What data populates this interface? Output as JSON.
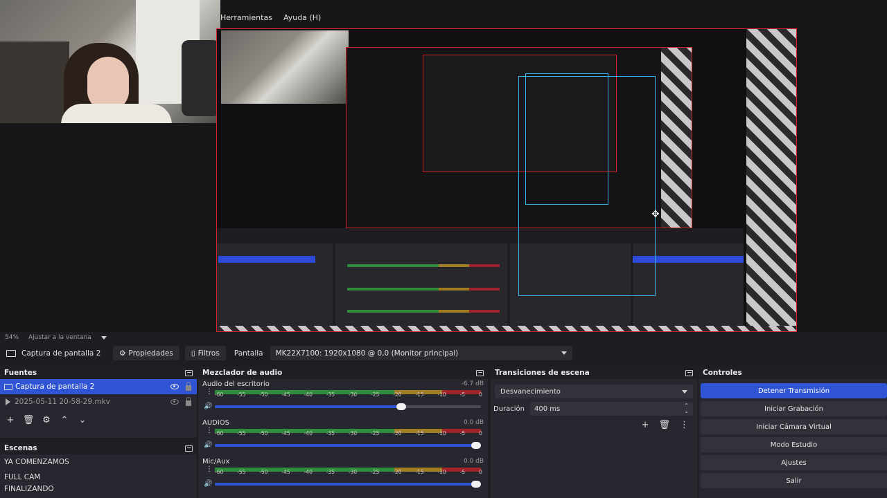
{
  "menu": {
    "tools": "Herramientas",
    "help": "Ayuda (H)"
  },
  "zoom": {
    "percent": "54%",
    "fit_label": "Ajustar a la ventana"
  },
  "source_toolbar": {
    "source_name": "Captura de pantalla 2",
    "properties_label": "Propiedades",
    "filters_label": "Filtros",
    "display_label": "Pantalla",
    "display_value": "MK22X7100: 1920x1080 @ 0,0 (Monitor principal)"
  },
  "sources": {
    "title": "Fuentes",
    "items": [
      {
        "label": "Captura de pantalla 2",
        "selected": true,
        "visible": true
      },
      {
        "label": "2025-05-11 20-58-29.mkv",
        "selected": false,
        "visible": false
      }
    ]
  },
  "scenes": {
    "title": "Escenas",
    "items": [
      {
        "label": "YA COMENZAMOS"
      },
      {
        "label": "FULL CAM"
      },
      {
        "label": "FINALIZANDO"
      }
    ]
  },
  "mixer": {
    "title": "Mezclador de audio",
    "ticks": [
      "-60",
      "-55",
      "-50",
      "-45",
      "-40",
      "-35",
      "-30",
      "-25",
      "-20",
      "-15",
      "-10",
      "-5",
      "0"
    ],
    "channels": [
      {
        "name": "Audio del escritorio",
        "db": "-6.7 dB",
        "level": 0.72,
        "volume": 0.72
      },
      {
        "name": "AUDIOS",
        "db": "0.0 dB",
        "level": 0.0,
        "volume": 1.0
      },
      {
        "name": "Mic/Aux",
        "db": "0.0 dB",
        "level": 0.55,
        "volume": 1.0
      }
    ]
  },
  "transitions": {
    "title": "Transiciones de escena",
    "selected": "Desvanecimiento",
    "duration_label": "Duración",
    "duration_value": "400 ms"
  },
  "controls": {
    "title": "Controles",
    "buttons": [
      {
        "label": "Detener Transmisión",
        "active": true
      },
      {
        "label": "Iniciar Grabación",
        "active": false
      },
      {
        "label": "Iniciar Cámara Virtual",
        "active": false
      },
      {
        "label": "Modo Estudio",
        "active": false
      },
      {
        "label": "Ajustes",
        "active": false
      },
      {
        "label": "Salir",
        "active": false
      }
    ]
  },
  "colors": {
    "accent": "#2f55d4",
    "canvas_border": "#d6232a",
    "selection": "#3ab4e4",
    "meter_green": "#2f8c3a",
    "meter_yellow": "#a07c22",
    "meter_red": "#a0222a"
  }
}
